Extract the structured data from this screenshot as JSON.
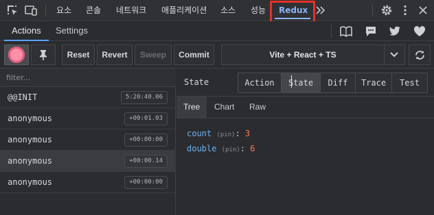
{
  "devtools_tabs": [
    {
      "label": "요소",
      "active": false
    },
    {
      "label": "콘솔",
      "active": false
    },
    {
      "label": "네트워크",
      "active": false
    },
    {
      "label": "애플리케이션",
      "active": false
    },
    {
      "label": "소스",
      "active": false
    },
    {
      "label": "성능",
      "active": false
    },
    {
      "label": "Redux",
      "active": true
    }
  ],
  "subtabs": {
    "actions": "Actions",
    "settings": "Settings"
  },
  "toolbar": {
    "reset": "Reset",
    "revert": "Revert",
    "sweep": "Sweep",
    "commit": "Commit",
    "instance": "Vite + React + TS"
  },
  "filter_placeholder": "filter...",
  "actions": [
    {
      "name": "@@INIT",
      "time": "5:20:40.06",
      "selected": false
    },
    {
      "name": "anonymous",
      "time": "+00:01.03",
      "selected": false
    },
    {
      "name": "anonymous",
      "time": "+00:00:00",
      "selected": false
    },
    {
      "name": "anonymous",
      "time": "+00:00.14",
      "selected": true
    },
    {
      "name": "anonymous",
      "time": "+00:00:00",
      "selected": false
    }
  ],
  "monitor": {
    "title": "State",
    "tabs": [
      "Action",
      "State",
      "Diff",
      "Trace",
      "Test"
    ],
    "active_tab": "State",
    "view_tabs": [
      "Tree",
      "Chart",
      "Raw"
    ],
    "active_view": "Tree"
  },
  "state_tree": [
    {
      "key": "count",
      "pin": "(pin)",
      "value": "3"
    },
    {
      "key": "double",
      "pin": "(pin)",
      "value": "6"
    }
  ],
  "colors": {
    "accent": "#8ab4f8",
    "highlight_box": "#e6312a",
    "value": "#ff7a4d",
    "key": "#6db3f2"
  }
}
